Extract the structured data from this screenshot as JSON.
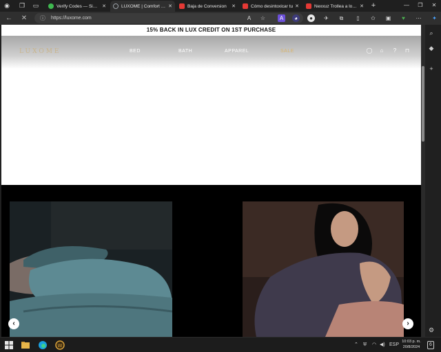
{
  "browser": {
    "tabs": [
      {
        "title": "Verify Codes — Simply",
        "favicon_color": "#3fb950",
        "active": false
      },
      {
        "title": "LUXOME | Comfort Ess",
        "favicon_color": "#9aa0a6",
        "active": true
      },
      {
        "title": "Baja de Conversion",
        "favicon_color": "#e53935",
        "active": false
      },
      {
        "title": "Cómo desintoxicar tu",
        "favicon_color": "#e53935",
        "active": false
      },
      {
        "title": "Nexxuz Trollea a los A",
        "favicon_color": "#e53935",
        "active": false
      }
    ],
    "new_tab": "+",
    "url": "https://luxome.com"
  },
  "site": {
    "promo": "15% BACK IN LUX CREDIT ON 1ST PURCHASE",
    "logo": "LUXOME",
    "nav": {
      "bed": "BED",
      "bath": "BATH",
      "apparel": "APPAREL",
      "sale": "SALE"
    },
    "prev_arrow": "‹",
    "next_arrow": "›"
  },
  "taskbar": {
    "lang": "ESP",
    "time": "10:03 p. m.",
    "date": "20/8/2024",
    "notifications": "6"
  },
  "colors": {
    "accent_gold": "#c9b48a",
    "sale": "#d9b46a"
  }
}
